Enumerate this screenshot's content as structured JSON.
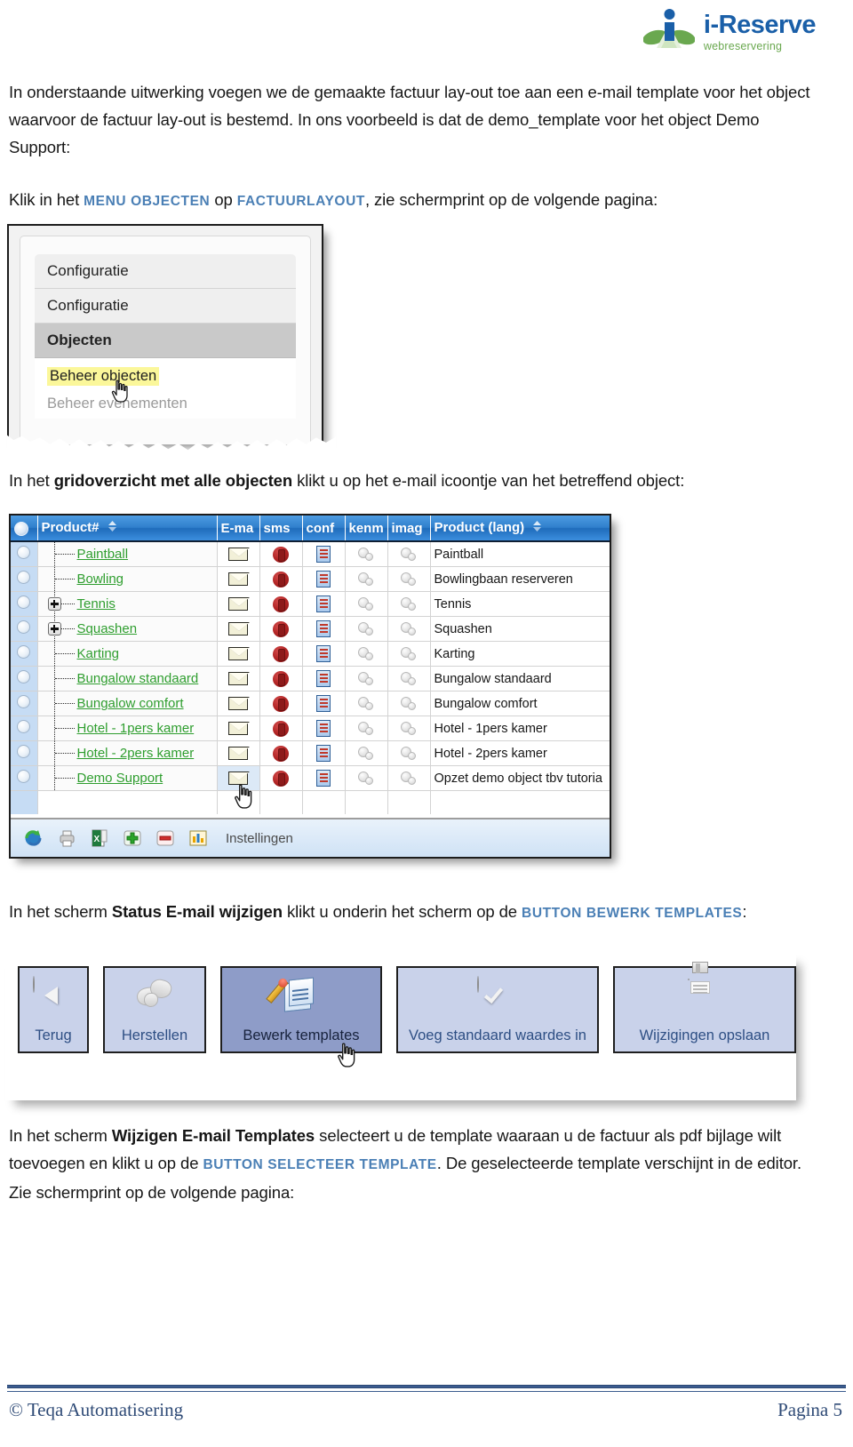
{
  "brand": {
    "name": "i-Reserve",
    "tagline": "webreservering",
    "blue": "#1a5fa8",
    "green": "#6aa84f"
  },
  "intro": {
    "line1_a": "In onderstaande uitwerking voegen we de gemaakte factuur lay-out toe aan een e-mail template",
    "line2_a": "voor het object waarvoor de factuur lay-out is bestemd. In ons voorbeeld is dat de demo_template",
    "line3_a": "voor het object Demo Support:"
  },
  "step1": {
    "pre": "Klik in het ",
    "link1": "MENU OBJECTEN",
    "mid": " op ",
    "link2": "FACTUURLAYOUT",
    "post": ", zie schermprint op de volgende pagina:"
  },
  "menu_screenshot": {
    "name": "objecten-menu",
    "rows": [
      {
        "label": "Configuratie",
        "type": "item"
      },
      {
        "label": "Configuratie",
        "type": "item"
      },
      {
        "label": "Objecten",
        "type": "section"
      },
      {
        "label": "Beheer objecten",
        "type": "leaf-highlight"
      },
      {
        "label": "Beheer evenementen",
        "type": "leaf-dim"
      }
    ]
  },
  "step2": {
    "pre": "In het ",
    "bold": "gridoverzicht met alle objecten",
    "post": " klikt u op het e-mail icoontje van het betreffend object:"
  },
  "grid_screenshot": {
    "columns": [
      {
        "key": "select",
        "label": ""
      },
      {
        "key": "product",
        "label": "Product#",
        "sortable": true
      },
      {
        "key": "email",
        "label": "E-ma"
      },
      {
        "key": "sms",
        "label": "sms"
      },
      {
        "key": "conf",
        "label": "conf"
      },
      {
        "key": "kenm",
        "label": "kenm"
      },
      {
        "key": "imag",
        "label": "imag"
      },
      {
        "key": "product_long",
        "label": "Product (lang)",
        "sortable": true
      }
    ],
    "rows": [
      {
        "product": "Paintball",
        "expandable": false,
        "product_long": "Paintball"
      },
      {
        "product": "Bowling",
        "expandable": false,
        "product_long": "Bowlingbaan reserveren"
      },
      {
        "product": "Tennis",
        "expandable": true,
        "product_long": "Tennis"
      },
      {
        "product": "Squashen",
        "expandable": true,
        "product_long": "Squashen"
      },
      {
        "product": "Karting",
        "expandable": false,
        "product_long": "Karting"
      },
      {
        "product": "Bungalow standaard",
        "expandable": false,
        "product_long": "Bungalow standaard"
      },
      {
        "product": "Bungalow comfort",
        "expandable": false,
        "product_long": "Bungalow comfort"
      },
      {
        "product": "Hotel - 1pers kamer",
        "expandable": false,
        "product_long": "Hotel - 1pers kamer"
      },
      {
        "product": "Hotel - 2pers kamer",
        "expandable": false,
        "product_long": "Hotel - 2pers kamer"
      },
      {
        "product": "Demo Support",
        "expandable": false,
        "product_long": "Opzet demo object tbv tutoria",
        "hovered": true
      }
    ],
    "toolbar": {
      "icons": [
        "refresh-icon",
        "print-icon",
        "excel-export-icon",
        "add-icon",
        "remove-icon",
        "chart-icon"
      ],
      "settings_label": "Instellingen"
    }
  },
  "step3": {
    "pre": "In het scherm ",
    "bold": "Status E-mail wijzigen",
    "mid": " klikt u onderin het scherm op de ",
    "link": "BUTTON BEWERK TEMPLATES",
    "post": ":"
  },
  "buttons_screenshot": {
    "buttons": [
      {
        "label": "Terug",
        "icon": "back-arrow-icon",
        "active": false
      },
      {
        "label": "Herstellen",
        "icon": "restore-icon",
        "active": false
      },
      {
        "label": "Bewerk templates",
        "icon": "edit-document-icon",
        "active": true
      },
      {
        "label": "Voeg standaard waardes in",
        "icon": "checkmark-icon",
        "active": false
      },
      {
        "label": "Wijzigingen opslaan",
        "icon": "save-floppy-icon",
        "active": false
      }
    ]
  },
  "step4": {
    "l1_pre": "In het scherm ",
    "l1_bold": "Wijzigen E-mail Templates",
    "l1_post": " selecteert u de template waaraan u de factuur als pdf",
    "l2_pre": "bijlage wilt toevoegen en klikt u op de ",
    "l2_link": "BUTTON SELECTEER TEMPLATE",
    "l2_post": ". De geselecteerde template",
    "l3": "verschijnt in de editor. Zie schermprint op de volgende pagina:"
  },
  "footer": {
    "copyright": "© Teqa Automatisering",
    "page": "Pagina 5"
  }
}
